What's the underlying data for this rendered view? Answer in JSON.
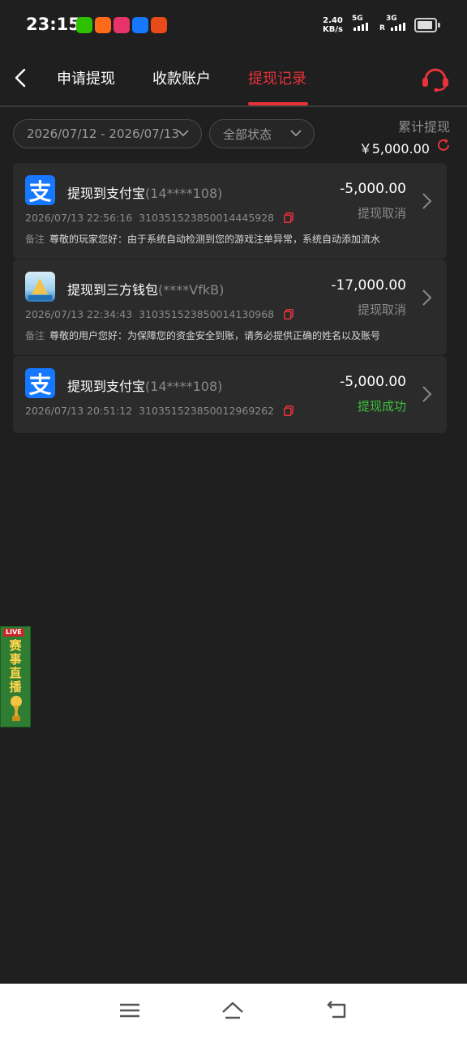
{
  "status_bar": {
    "time": "23:15",
    "net_speed_value": "2.40",
    "net_speed_unit": "KB/s",
    "sig1_label": "5G",
    "sig2_label": "3G",
    "sig2_sub": "R"
  },
  "header": {
    "tabs": [
      {
        "label": "申请提现"
      },
      {
        "label": "收款账户"
      },
      {
        "label": "提现记录"
      }
    ],
    "active_tab_color": "#e8323a"
  },
  "filters": {
    "date_range": "2026/07/12 - 2026/07/13",
    "status": "全部状态"
  },
  "cumulative": {
    "label": "累计提现",
    "value": "￥5,000.00"
  },
  "records": [
    {
      "icon": "alipay-icon",
      "title": "提现到支付宝",
      "account": "(14****108)",
      "amount": "-5,000.00",
      "status": "提现取消",
      "datetime": "2026/07/13 22:56:16",
      "order_no": "310351523850014445928",
      "note_label": "备注",
      "note": "尊敬的玩家您好：由于系统自动检测到您的游戏注单异常，系统自动添加流水"
    },
    {
      "icon": "wallet-icon",
      "title": "提现到三方钱包",
      "account": "(****VfkB)",
      "amount": "-17,000.00",
      "status": "提现取消",
      "datetime": "2026/07/13 22:34:43",
      "order_no": "310351523850014130968",
      "note_label": "备注",
      "note": "尊敬的用户您好：为保障您的资金安全到账，请务必提供正确的姓名以及账号"
    },
    {
      "icon": "alipay-icon",
      "title": "提现到支付宝",
      "account": "(14****108)",
      "amount": "-5,000.00",
      "status": "提现成功",
      "datetime": "2026/07/13 20:51:12",
      "order_no": "310351523850012969262"
    }
  ],
  "live_widget": {
    "badge": "LIVE",
    "text": "赛事直播"
  },
  "alipay_glyph": "支",
  "colors": {
    "accent_red": "#e8323a",
    "success_green": "#3fbf3f",
    "alipay_blue": "#1677ff"
  }
}
